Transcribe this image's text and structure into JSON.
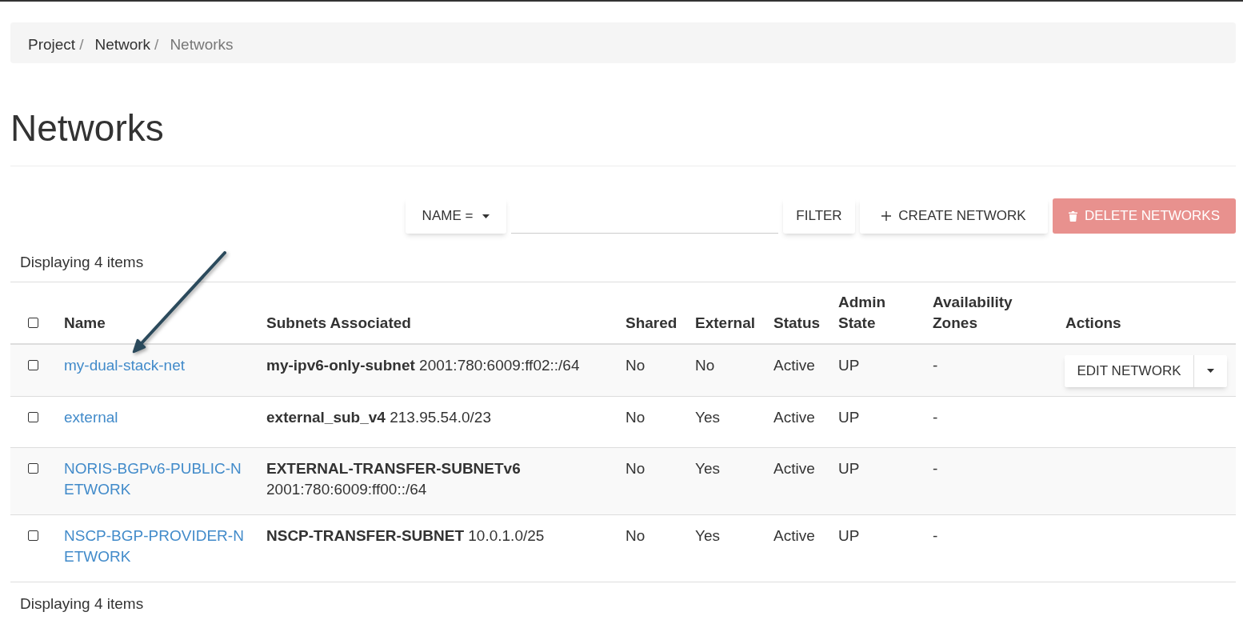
{
  "breadcrumb": [
    {
      "label": "Project",
      "separator": "/",
      "current": false
    },
    {
      "label": "Network",
      "separator": "/",
      "current": false
    },
    {
      "label": "Networks",
      "current": true
    }
  ],
  "page_title": "Networks",
  "toolbar": {
    "filter_field": {
      "label": "NAME ="
    },
    "buttons": [
      {
        "kind": "filter",
        "label": "FILTER",
        "disabled": false
      },
      {
        "kind": "create",
        "label": "CREATE NETWORK",
        "disabled": false
      },
      {
        "kind": "delete",
        "label": "DELETE NETWORKS",
        "disabled": true
      }
    ]
  },
  "item_count_top": "Displaying 4 items",
  "table": {
    "select_all": {
      "checked": false
    },
    "columns": [
      "Name",
      "Subnets Associated",
      "Shared",
      "External",
      "Status",
      "Admin State",
      "Availability Zones",
      "Actions"
    ],
    "rows": [
      {
        "checked": false,
        "name": "my-dual-stack-net",
        "subnets": "**my-ipv6-only-subnet** 2001:780:6009:ff02::/64",
        "shared": "No",
        "external": "No",
        "status": "Active",
        "admin_state": "UP",
        "availability_zones": "-",
        "actions": {
          "label": "EDIT NETWORK"
        }
      },
      {
        "checked": false,
        "name": "external",
        "subnets": "**external_sub_v4** 213.95.54.0/23",
        "shared": "No",
        "external": "Yes",
        "status": "Active",
        "admin_state": "UP",
        "availability_zones": "-"
      },
      {
        "checked": false,
        "name": "NORIS-BGPv6-PUBLIC-NETWORK",
        "subnets": "**EXTERNAL-TRANSFER-SUBNETv6** 2001:780:6009:ff00::/64",
        "shared": "No",
        "external": "Yes",
        "status": "Active",
        "admin_state": "UP",
        "availability_zones": "-"
      },
      {
        "checked": false,
        "name": "NSCP-BGP-PROVIDER-NETWORK",
        "subnets": "**NSCP-TRANSFER-SUBNET** 10.0.1.0/25",
        "shared": "No",
        "external": "Yes",
        "status": "Active",
        "admin_state": "UP",
        "availability_zones": "-"
      }
    ]
  },
  "item_count_bottom": "Displaying 4 items"
}
